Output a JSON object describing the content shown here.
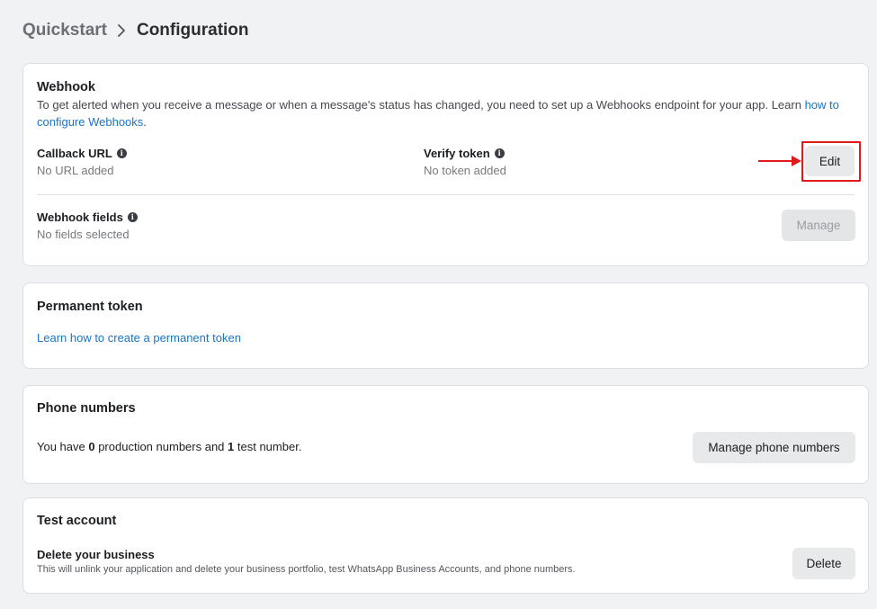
{
  "breadcrumb": {
    "parent": "Quickstart",
    "current": "Configuration"
  },
  "webhook": {
    "title": "Webhook",
    "description_prefix": "To get alerted when you receive a message or when a message's status has changed, you need to set up a Webhooks endpoint for your app. Learn",
    "link_text": "how to configure Webhooks",
    "link_suffix": ".",
    "callback_url": {
      "label": "Callback URL",
      "value": "No URL added"
    },
    "verify_token": {
      "label": "Verify token",
      "value": "No token added"
    },
    "edit_label": "Edit",
    "fields": {
      "label": "Webhook fields",
      "value": "No fields selected"
    },
    "manage_label": "Manage"
  },
  "permanent_token": {
    "title": "Permanent token",
    "link_text": "Learn how to create a permanent token"
  },
  "phone_numbers": {
    "title": "Phone numbers",
    "text_1": "You have ",
    "production_count": "0",
    "text_2": " production numbers and ",
    "test_count": "1",
    "text_3": " test number.",
    "manage_label": "Manage phone numbers"
  },
  "test_account": {
    "title": "Test account",
    "delete_title": "Delete your business",
    "delete_description": "This will unlink your application and delete your business portfolio, test WhatsApp Business Accounts, and phone numbers.",
    "delete_label": "Delete"
  },
  "colors": {
    "accent_link": "#1b74c4",
    "annotation_red": "#e0191b",
    "button_bg": "#e8e9eb"
  },
  "icons": {
    "breadcrumb_separator": "chevron-right-icon",
    "info": "info-icon",
    "annotation_arrow": "arrow-right-icon"
  }
}
